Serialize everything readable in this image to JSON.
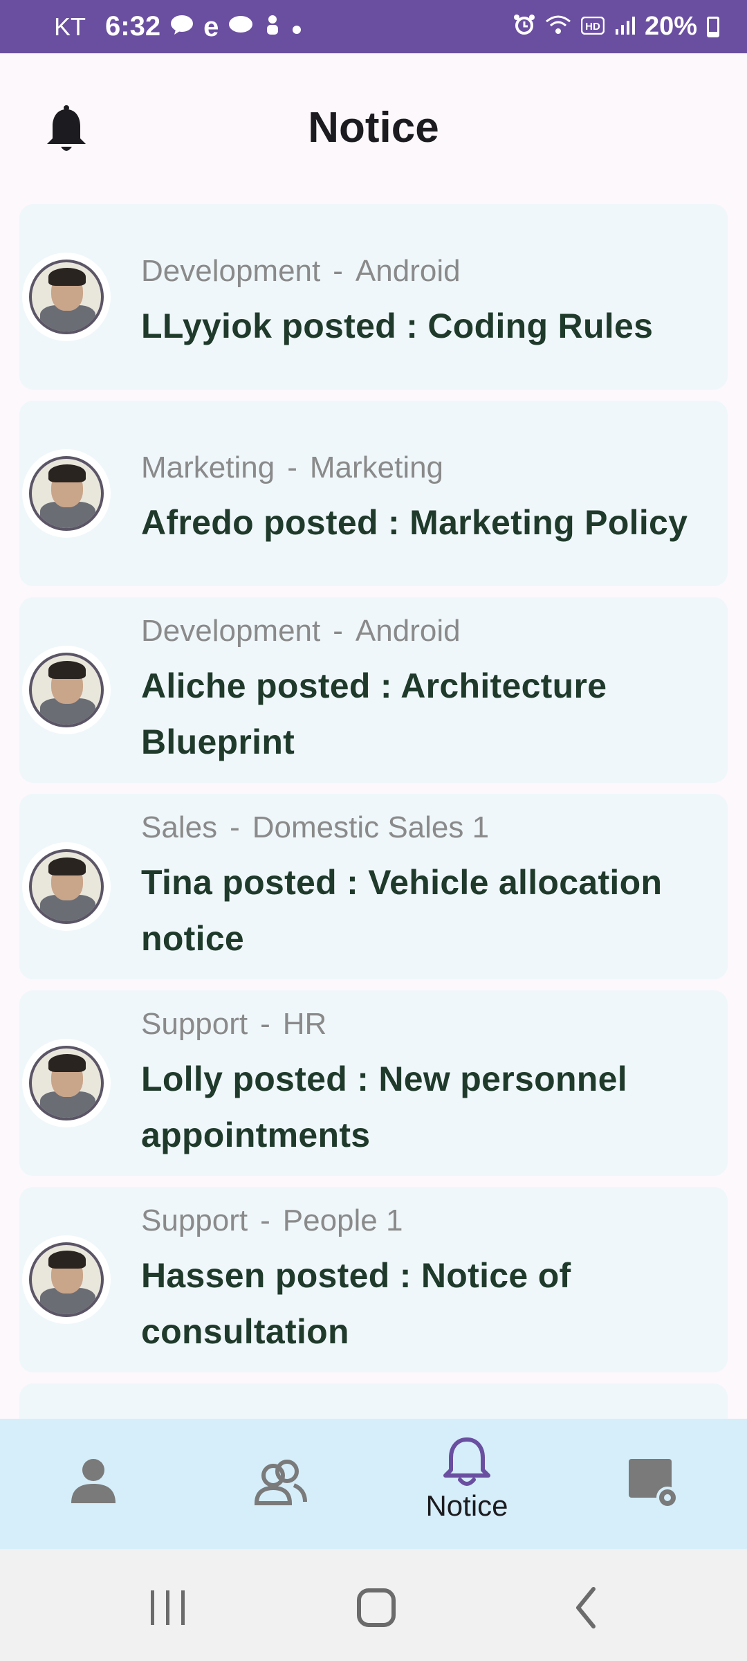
{
  "status_bar": {
    "carrier": "KT",
    "time": "6:32",
    "battery": "20%",
    "left_icons": [
      "talk-icon",
      "e-icon",
      "chat-icon",
      "game-icon",
      "dot-icon"
    ],
    "right_icons": [
      "alarm-icon",
      "wifi-icon",
      "hd-icon",
      "signal-icon",
      "battery-icon"
    ]
  },
  "header": {
    "title": "Notice",
    "icon": "bell-icon"
  },
  "notices": [
    {
      "department": "Development",
      "team": "Android",
      "title": "LLyyiok posted : Coding Rules"
    },
    {
      "department": "Marketing",
      "team": "Marketing",
      "title": "Afredo posted : Marketing Policy"
    },
    {
      "department": "Development",
      "team": "Android",
      "title": "Aliche posted : Architecture Blueprint"
    },
    {
      "department": "Sales",
      "team": "Domestic Sales 1",
      "title": "Tina posted : Vehicle allocation notice"
    },
    {
      "department": "Support",
      "team": "HR",
      "title": "Lolly posted : New personnel appointments"
    },
    {
      "department": "Support",
      "team": "People 1",
      "title": "Hassen posted : Notice of consultation"
    }
  ],
  "separator": "-",
  "bottom_nav": {
    "items": [
      {
        "icon": "person-icon",
        "label": ""
      },
      {
        "icon": "group-icon",
        "label": ""
      },
      {
        "icon": "bell-outline-icon",
        "label": "Notice"
      },
      {
        "icon": "settings-board-icon",
        "label": ""
      }
    ],
    "active": "Notice",
    "active_color": "#6a4fa0"
  },
  "colors": {
    "status_bar": "#6a4fa0",
    "card_bg": "#eff7fa",
    "nav_bg": "#d5eefa",
    "title_text": "#1f3a2b"
  }
}
